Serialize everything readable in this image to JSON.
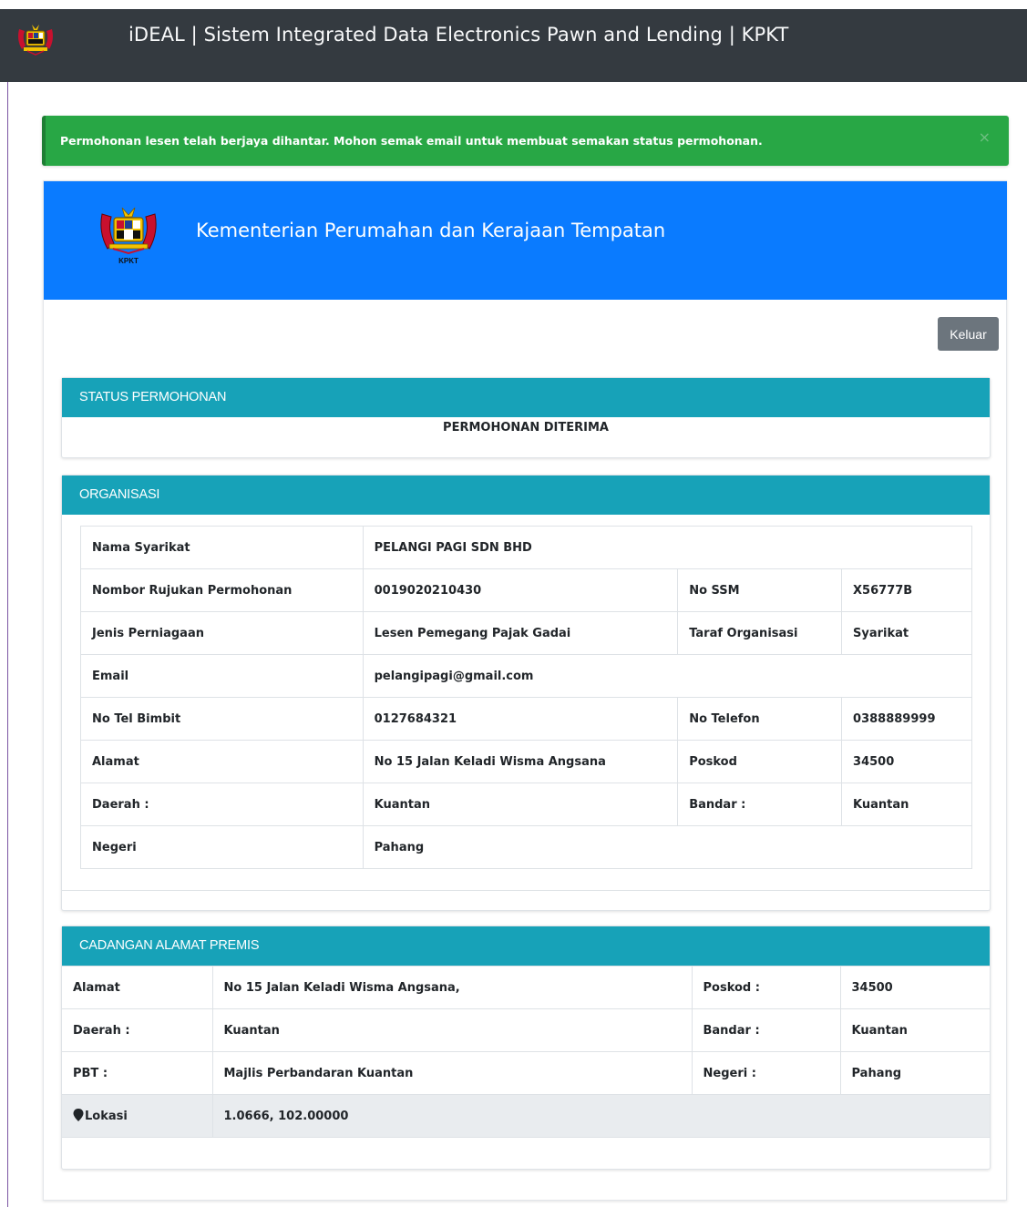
{
  "app": {
    "title": "iDEAL | Sistem Integrated Data Electronics Pawn and Lending | KPKT"
  },
  "alert": {
    "message": "Permohonan lesen telah berjaya dihantar. Mohon semak email untuk membuat semakan status permohonan.",
    "close_symbol": "×"
  },
  "banner": {
    "ministry": "Kementerian Perumahan dan Kerajaan Tempatan",
    "crest_caption": "KPKT"
  },
  "logout_label": "Keluar",
  "status": {
    "header": "STATUS PERMOHONAN",
    "value": "PERMOHONAN DITERIMA"
  },
  "organisasi": {
    "header": "ORGANISASI",
    "nama_syarikat_label": "Nama Syarikat",
    "nama_syarikat": "PELANGI PAGI SDN BHD",
    "rujukan_label": "Nombor Rujukan Permohonan",
    "rujukan": "0019020210430",
    "ssm_label": "No SSM",
    "ssm": "X56777B",
    "jenis_label": "Jenis Perniagaan",
    "jenis": "Lesen Pemegang Pajak Gadai",
    "taraf_label": "Taraf Organisasi",
    "taraf": "Syarikat",
    "email_label": "Email",
    "email": "pelangipagi@gmail.com",
    "tel_bimbit_label": "No Tel Bimbit",
    "tel_bimbit": "0127684321",
    "telefon_label": "No Telefon",
    "telefon": "0388889999",
    "alamat_label": "Alamat",
    "alamat": "No 15 Jalan Keladi Wisma Angsana",
    "poskod_label": "Poskod",
    "poskod": "34500",
    "daerah_label": "Daerah :",
    "daerah": "Kuantan",
    "bandar_label": "Bandar :",
    "bandar": "Kuantan",
    "negeri_label": "Negeri",
    "negeri": "Pahang"
  },
  "premis": {
    "header": "CADANGAN ALAMAT PREMIS",
    "alamat_label": "Alamat",
    "alamat": "No 15 Jalan Keladi Wisma Angsana,",
    "poskod_label": "Poskod :",
    "poskod": "34500",
    "daerah_label": "Daerah :",
    "daerah": "Kuantan",
    "bandar_label": "Bandar :",
    "bandar": "Kuantan",
    "pbt_label": "PBT :",
    "pbt": "Majlis Perbandaran Kuantan",
    "negeri_label": "Negeri :",
    "negeri": "Pahang",
    "lokasi_label": "Lokasi",
    "lokasi": "1.0666, 102.00000"
  },
  "colors": {
    "topbar": "#343a40",
    "success": "#28a745",
    "primary": "#0a7bff",
    "info": "#17a2b8",
    "secondary": "#6c757d"
  },
  "icons": {
    "crest": "malaysia-coat-of-arms-icon",
    "close": "close-icon",
    "location": "map-pin-icon"
  }
}
